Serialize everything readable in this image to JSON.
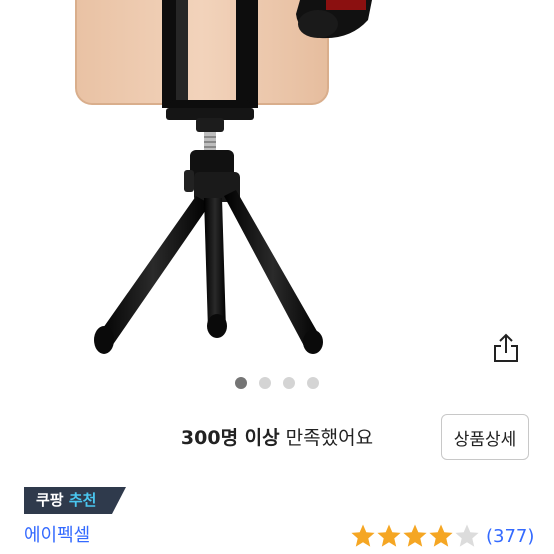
{
  "satisfaction": {
    "count_text": "300명 이상",
    "suffix_text": " 만족했어요"
  },
  "detail_button_label": "상품상세",
  "carousel": {
    "total": 4,
    "active_index": 0
  },
  "badge": {
    "part1": "쿠팡",
    "part2": "추천"
  },
  "brand_name": "에이펙셀",
  "rating": {
    "stars": 4,
    "max": 5,
    "review_count": "(377)"
  },
  "colors": {
    "accent_blue": "#346aff",
    "star_orange": "#f5a623",
    "badge_bg": "#2f3a4c",
    "badge_highlight": "#4ac6ef"
  },
  "icons": {
    "share": "share-icon",
    "star": "star-icon"
  }
}
